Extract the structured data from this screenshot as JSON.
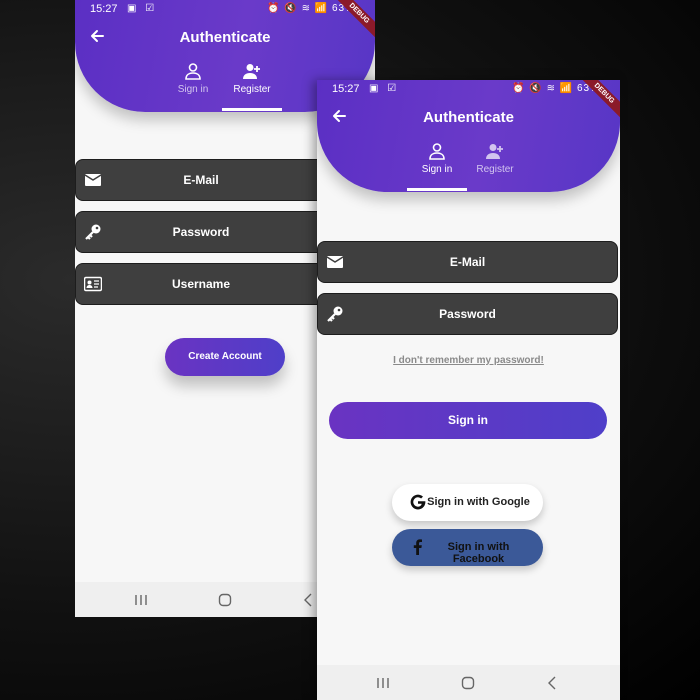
{
  "status_bar": {
    "time": "15:27",
    "icons": "▣ ☑",
    "right": "⏰ 🔇 ≋ 📶 63%",
    "debug_label": "DEBUG"
  },
  "header": {
    "title": "Authenticate",
    "tabs": [
      {
        "label": "Sign in",
        "icon": "person-icon"
      },
      {
        "label": "Register",
        "icon": "person-add-icon"
      }
    ]
  },
  "register_screen": {
    "active_tab": "Register",
    "fields": [
      {
        "label": "E-Mail",
        "icon": "email-icon"
      },
      {
        "label": "Password",
        "icon": "key-icon"
      },
      {
        "label": "Username",
        "icon": "id-card-icon"
      }
    ],
    "submit_label": "Create Account"
  },
  "signin_screen": {
    "active_tab": "Sign in",
    "fields": [
      {
        "label": "E-Mail",
        "icon": "email-icon"
      },
      {
        "label": "Password",
        "icon": "key-icon"
      }
    ],
    "forgot_label": "I don't remember my password!",
    "submit_label": "Sign in",
    "google_label": "Sign in with Google",
    "facebook_label": "Sign in with Facebook"
  },
  "navbar": {
    "icons": [
      "recents-icon",
      "home-icon",
      "back-icon"
    ]
  },
  "colors": {
    "accent": "#5b2fc4",
    "field_bg": "#3f3f3f",
    "facebook": "#3b5998",
    "background": "#f7f7f7"
  }
}
